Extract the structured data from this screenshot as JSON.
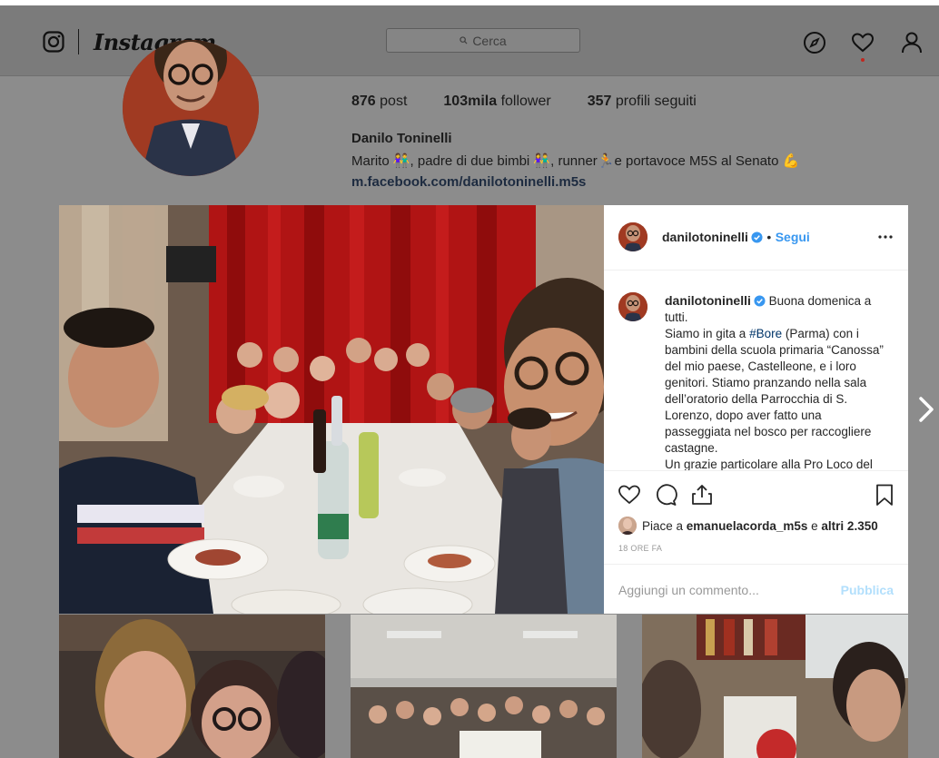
{
  "nav": {
    "wordmark": "Instagram",
    "search_placeholder": "Cerca",
    "icons": [
      "instagram-glyph-icon",
      "compass-icon",
      "heart-icon",
      "user-icon"
    ]
  },
  "profile": {
    "posts_count": "876",
    "posts_label": "post",
    "followers_count": "103mila",
    "followers_label": "follower",
    "following_count": "357",
    "following_label": "profili seguiti",
    "name": "Danilo Toninelli",
    "bio": "Marito 👫, padre di due bimbi 👫, runner🏃e portavoce M5S al Senato 💪",
    "link": "m.facebook.com/danilotoninelli.m5s"
  },
  "post": {
    "username": "danilotoninelli",
    "separator": "•",
    "follow_label": "Segui",
    "caption_user": "danilotoninelli",
    "caption_part1": "Buona domenica a tutti.",
    "caption_part2": "Siamo in gita a",
    "hashtag": "#Bore",
    "caption_part3": "(Parma) con i bambini della scuola primaria “Canossa” del mio paese, Castelleone, e i loro genitori. Stiamo pranzando nella sala dell’oratorio della Parrocchia di S. Lorenzo, dopo aver fatto una passeggiata nel bosco per raccogliere castagne.",
    "caption_part4": "Un grazie particolare alla Pro Loco del",
    "likes_prefix": "Piace a",
    "likes_user": "emanuelacorda_m5s",
    "likes_suffix": "e",
    "likes_others": "altri 2.350",
    "time_ago": "18 ORE FA",
    "comment_placeholder": "Aggiungi un commento...",
    "publish_label": "Pubblica"
  },
  "colors": {
    "accent_blue": "#3897f0",
    "publish_disabled": "#b2dffc",
    "curtain_red": "#b01414"
  }
}
